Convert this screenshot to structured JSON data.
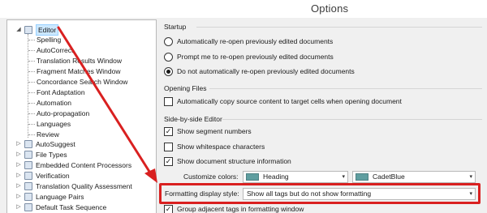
{
  "window": {
    "title": "Options"
  },
  "tree": {
    "selected": "Editor",
    "root": {
      "label": "Editor",
      "toggle": "◢"
    },
    "children": [
      "Spelling",
      "AutoCorrect",
      "Translation Results Window",
      "Fragment Matches Window",
      "Concordance Search Window",
      "Font Adaptation",
      "Automation",
      "Auto-propagation",
      "Languages",
      "Review"
    ],
    "siblings": [
      {
        "label": "AutoSuggest",
        "toggle": "▷"
      },
      {
        "label": "File Types",
        "toggle": "▷"
      },
      {
        "label": "Embedded Content Processors",
        "toggle": "▷"
      },
      {
        "label": "Verification",
        "toggle": "▷"
      },
      {
        "label": "Translation Quality Assessment",
        "toggle": "▷"
      },
      {
        "label": "Language Pairs",
        "toggle": "▷"
      },
      {
        "label": "Default Task Sequence",
        "toggle": "▷"
      }
    ]
  },
  "startup": {
    "title": "Startup",
    "options": [
      {
        "label": "Automatically re-open previously edited documents",
        "selected": false
      },
      {
        "label": "Prompt me to re-open previously edited documents",
        "selected": false
      },
      {
        "label": "Do not automatically re-open previously edited documents",
        "selected": true
      }
    ]
  },
  "opening_files": {
    "title": "Opening Files",
    "options": [
      {
        "label": "Automatically copy source content to target cells when opening document",
        "checked": false
      }
    ]
  },
  "side_by_side": {
    "title": "Side-by-side Editor",
    "options": [
      {
        "label": "Show segment numbers",
        "checked": true
      },
      {
        "label": "Show whitespace characters",
        "checked": false
      },
      {
        "label": "Show document structure information",
        "checked": true
      }
    ],
    "customize_colors": {
      "label": "Customize colors:",
      "element_value": "Heading",
      "color_value": "CadetBlue",
      "swatch_color": "#5f9ea0"
    },
    "formatting_display": {
      "label": "Formatting display style:",
      "value": "Show all tags but do not show formatting"
    },
    "group_tags": {
      "label": "Group adjacent tags in formatting window",
      "checked": true
    }
  },
  "annotation": {
    "color": "#d92020"
  },
  "glyphs": {
    "check": "✓",
    "dropdown": "▾"
  }
}
